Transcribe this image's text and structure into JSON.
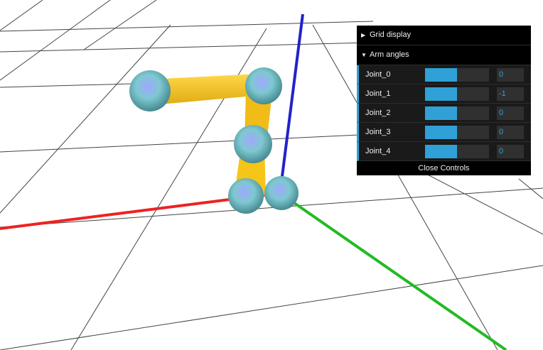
{
  "gui": {
    "folders": [
      {
        "label": "Grid display",
        "open": false
      },
      {
        "label": "Arm angles",
        "open": true
      }
    ],
    "controls": [
      {
        "label": "Joint_0",
        "value": "0",
        "fill_fraction": 0.5
      },
      {
        "label": "Joint_1",
        "value": "-1",
        "fill_fraction": 0.5
      },
      {
        "label": "Joint_2",
        "value": "0",
        "fill_fraction": 0.5
      },
      {
        "label": "Joint_3",
        "value": "0",
        "fill_fraction": 0.5
      },
      {
        "label": "Joint_4",
        "value": "0",
        "fill_fraction": 0.5
      }
    ],
    "close_label": "Close Controls",
    "accent_color": "#2fa1d6"
  },
  "scene": {
    "axis_colors": {
      "x": "#ee2222",
      "y": "#2222cc",
      "z": "#22bb22"
    },
    "arm_color": "#f5c518",
    "joint_color": "#7ec8d0",
    "grid_color": "#444444"
  }
}
